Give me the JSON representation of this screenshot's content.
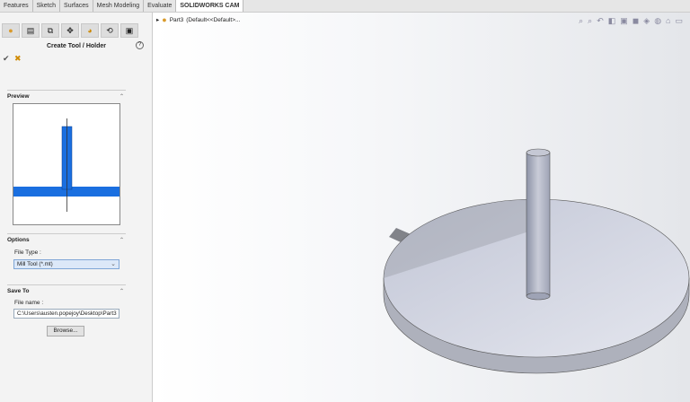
{
  "tabs": [
    "Features",
    "Sketch",
    "Surfaces",
    "Mesh Modeling",
    "Evaluate",
    "SOLIDWORKS CAM"
  ],
  "active_tab": "SOLIDWORKS CAM",
  "panel": {
    "title": "Create Tool / Holder",
    "help": "?",
    "preview_label": "Preview",
    "options_label": "Options",
    "file_type_label": "File Type :",
    "file_type_value": "Mill Tool (*.mt)",
    "save_to_label": "Save To",
    "file_name_label": "File name :",
    "file_name_value": "C:\\Users\\austen.popejoy\\Desktop\\Part3",
    "browse": "Browse..."
  },
  "tree": {
    "item": "Part3",
    "config": "(Default<<Default>..."
  },
  "colors": {
    "tool_blue": "#1a6fe0"
  }
}
